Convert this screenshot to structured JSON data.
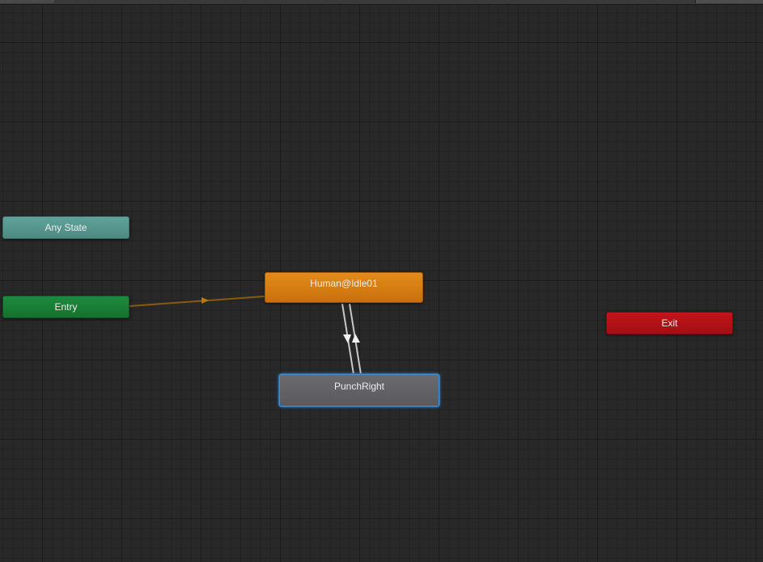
{
  "states": {
    "any_state": "Any State",
    "entry": "Entry",
    "idle": "Human@Idle01",
    "punch": "PunchRight",
    "exit": "Exit"
  },
  "colors": {
    "any_state": "#5a9e95",
    "entry": "#1a7f36",
    "idle": "#d97e14",
    "punch": "#636367",
    "punch_selection": "#3f8fd8",
    "exit": "#b31217",
    "entry_transition": "#8a5a10",
    "transition": "#c8c8c8",
    "grid_background": "#282828"
  },
  "transitions": [
    {
      "from": "Entry",
      "to": "Human@Idle01"
    },
    {
      "from": "Human@Idle01",
      "to": "PunchRight"
    },
    {
      "from": "PunchRight",
      "to": "Human@Idle01"
    }
  ]
}
